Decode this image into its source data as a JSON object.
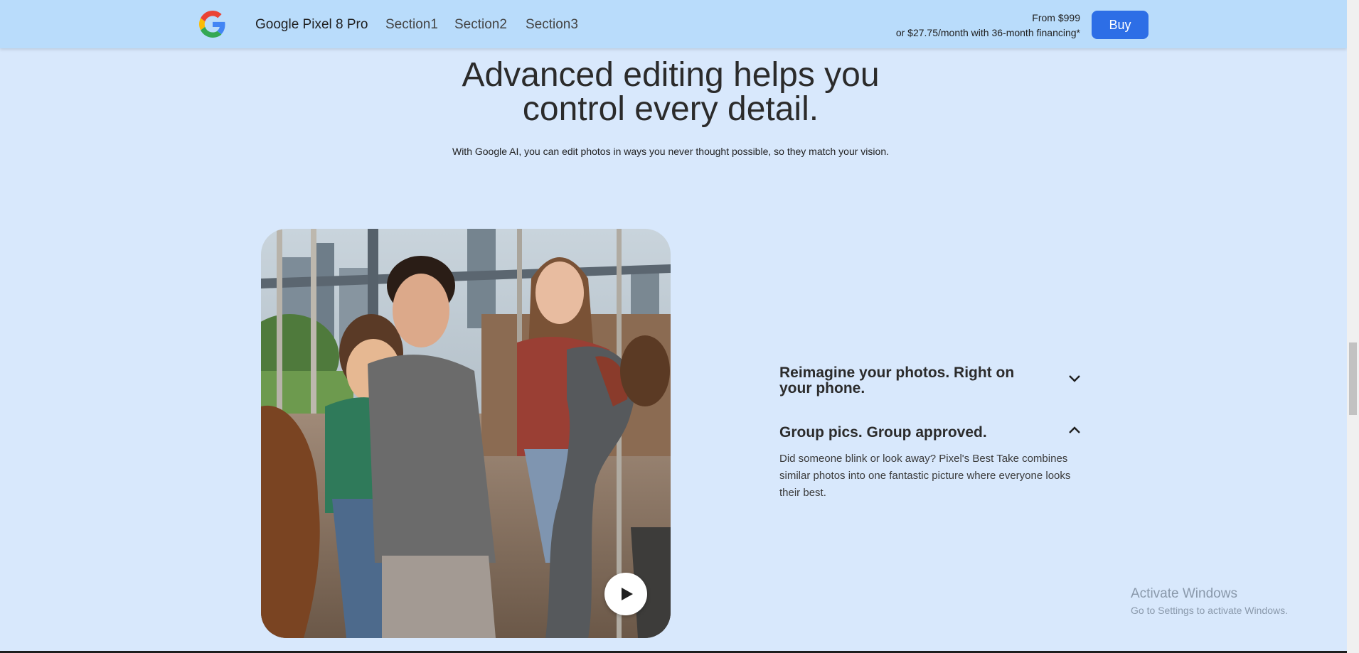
{
  "header": {
    "brand": "Google Pixel 8 Pro",
    "nav": [
      "Section1",
      "Section2",
      "Section3"
    ],
    "price_line1": "From $999",
    "price_line2": "or $27.75/month with 36-month financing*",
    "buy_label": "Buy"
  },
  "hero": {
    "title_line1": "Advanced editing helps you",
    "title_line2": "control every detail.",
    "subtitle": "With Google AI, you can edit photos in ways you never thought possible, so they match your vision."
  },
  "accordion": [
    {
      "title": "Reimagine your photos. Right on your phone.",
      "expanded": false,
      "icon": "chevron-down-icon"
    },
    {
      "title": "Group pics. Group approved.",
      "expanded": true,
      "icon": "chevron-up-icon",
      "body": "Did someone blink or look away? Pixel's Best Take combines similar photos into one fantastic picture where everyone looks their best."
    }
  ],
  "media": {
    "icon": "play-icon"
  },
  "watermark": {
    "title": "Activate Windows",
    "subtitle": "Go to Settings to activate Windows."
  },
  "colors": {
    "background": "#d8e8fc",
    "header": "#b9dcfb",
    "accent": "#2d6ee6"
  }
}
